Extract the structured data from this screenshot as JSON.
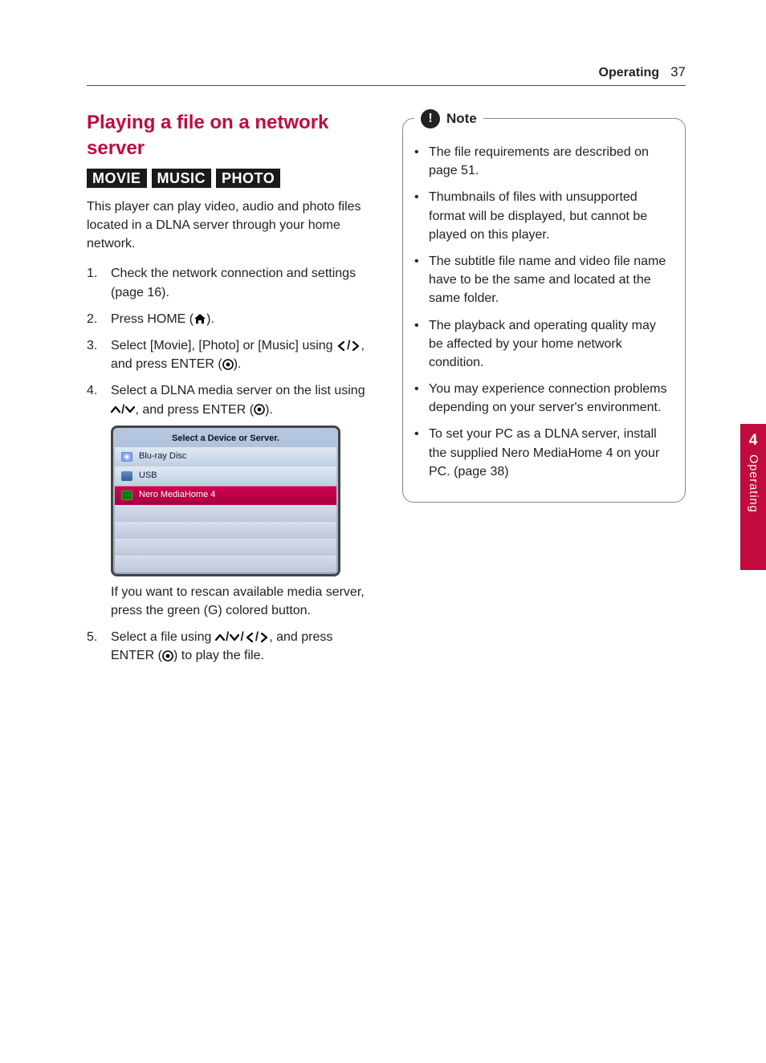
{
  "header": {
    "section": "Operating",
    "page": "37"
  },
  "sideTab": {
    "chapter": "4",
    "label": "Operating"
  },
  "section": {
    "title": "Playing a file on a network server",
    "tags": [
      "MOVIE",
      "MUSIC",
      "PHOTO"
    ],
    "intro": "This player can play video, audio and photo files located in a DLNA server through your home network."
  },
  "steps": [
    {
      "n": "1.",
      "text": "Check the network connection and settings (page 16)."
    },
    {
      "n": "2.",
      "pre": "Press HOME (",
      "post": ")."
    },
    {
      "n": "3.",
      "pre": "Select [Movie], [Photo] or [Music] using ",
      "mid": ", and press ENTER (",
      "post": ")."
    },
    {
      "n": "4.",
      "pre": "Select a DLNA media server on the list using ",
      "mid": ", and press ENTER (",
      "post": ").",
      "sub": "If you want to rescan available media server, press the green (G) colored button."
    },
    {
      "n": "5.",
      "pre": "Select a file using ",
      "mid": ", and press ENTER (",
      "post": ") to play the file."
    }
  ],
  "screen": {
    "title": "Select a Device or Server.",
    "rows": [
      {
        "label": "Blu-ray Disc",
        "icon": "disc",
        "selected": false
      },
      {
        "label": "USB",
        "icon": "usb",
        "selected": false
      },
      {
        "label": "Nero MediaHome 4",
        "icon": "nero",
        "selected": true
      }
    ]
  },
  "note": {
    "label": "Note",
    "items": [
      "The file requirements are described on page 51.",
      "Thumbnails of files with unsupported format will be displayed, but cannot be played on this player.",
      "The subtitle file name and video file name have to be the same and located at the same folder.",
      "The playback and operating quality may be affected by your home network condition.",
      "You may experience connection problems depending on your server's environment.",
      "To set your PC as a DLNA server, install the supplied Nero MediaHome 4 on your PC. (page 38)"
    ]
  }
}
